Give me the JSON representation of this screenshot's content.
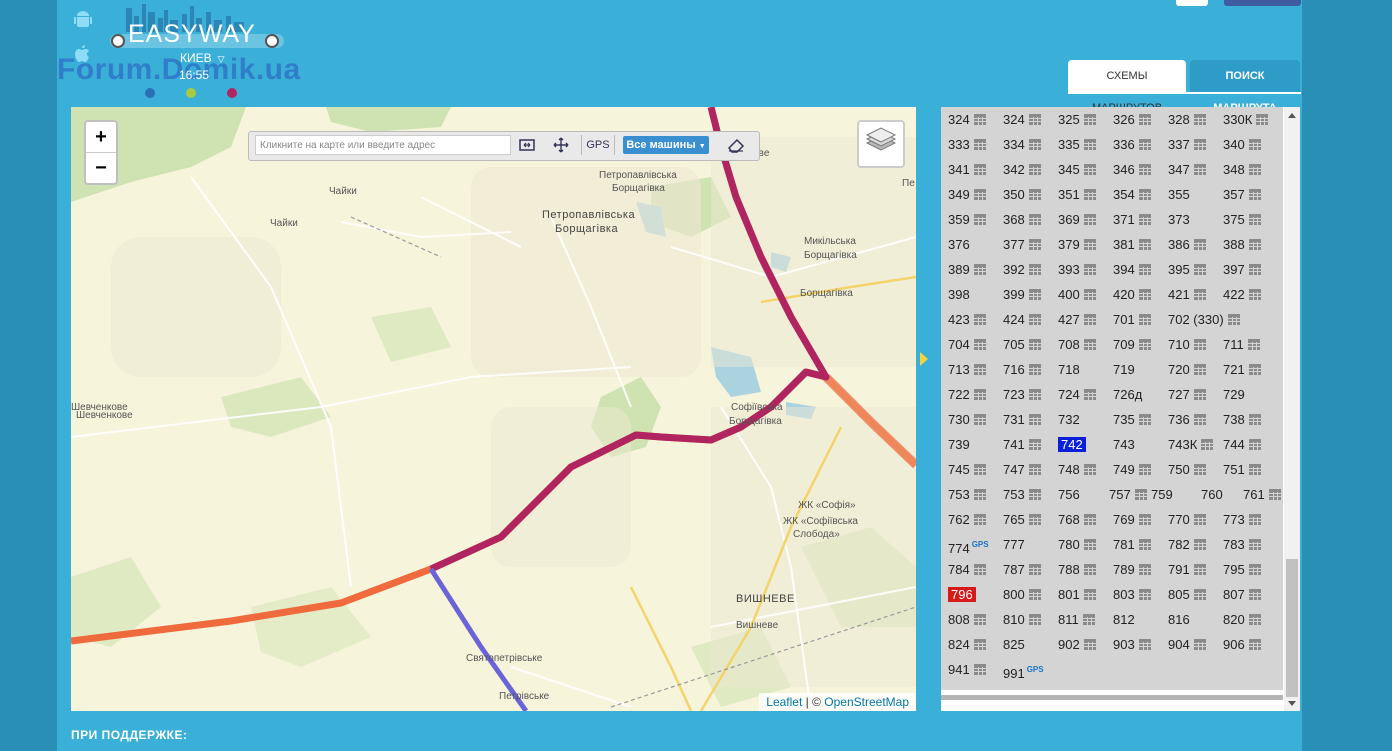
{
  "header": {
    "logo": "EASYWAY",
    "watermark": "Forum.Domik.ua",
    "city": "КИЕВ",
    "time": "16:55"
  },
  "tabs": [
    {
      "label": "СХЕМЫ МАРШРУТОВ",
      "active": true
    },
    {
      "label": "ПОИСК МАРШРУТА",
      "active": false
    }
  ],
  "map": {
    "search_placeholder": "Кликните на карте или введите адрес",
    "gps_label": "GPS",
    "vehicles_label": "Все машины",
    "zoom_in": "+",
    "zoom_out": "−",
    "attribution_leaflet": "Leaflet",
    "attribution_sep": " | © ",
    "attribution_osm": "OpenStreetMap",
    "places": [
      "Чайки",
      "Чайки",
      "Петропавлівська Борщагівка",
      "Петропавлівська",
      "Борщагівка",
      "Петропавлівська",
      "Борщагівка",
      "Микільська",
      "Борщагівка",
      "Борщагівка",
      "Шевченкове",
      "Шевченкове",
      "Софіївська",
      "Борщагівка",
      "ЖК «Софія»",
      "ЖК «Софіївська",
      "Слобода»",
      "ВИШНЕВЕ",
      "Вишневе",
      "Святопетрівське",
      "Петрівське",
      "евe",
      "Пе"
    ]
  },
  "routes_panel": {
    "rows": [
      [
        {
          "n": "324",
          "s": true
        },
        {
          "n": "324",
          "s": true
        },
        {
          "n": "325",
          "s": true
        },
        {
          "n": "326",
          "s": true
        },
        {
          "n": "328",
          "s": true
        },
        {
          "n": "330К",
          "s": true
        }
      ],
      [
        {
          "n": "333",
          "s": true
        },
        {
          "n": "334",
          "s": true
        },
        {
          "n": "335",
          "s": true
        },
        {
          "n": "336",
          "s": true
        },
        {
          "n": "337",
          "s": true
        },
        {
          "n": "340",
          "s": true
        }
      ],
      [
        {
          "n": "341",
          "s": true
        },
        {
          "n": "342",
          "s": true
        },
        {
          "n": "345",
          "s": true
        },
        {
          "n": "346",
          "s": true
        },
        {
          "n": "347",
          "s": true
        },
        {
          "n": "348",
          "s": true
        }
      ],
      [
        {
          "n": "349",
          "s": true
        },
        {
          "n": "350",
          "s": true
        },
        {
          "n": "351",
          "s": true
        },
        {
          "n": "354",
          "s": true
        },
        {
          "n": "355",
          "s": false
        },
        {
          "n": "357",
          "s": true
        }
      ],
      [
        {
          "n": "359",
          "s": true
        },
        {
          "n": "368",
          "s": true
        },
        {
          "n": "369",
          "s": true
        },
        {
          "n": "371",
          "s": true
        },
        {
          "n": "373",
          "s": false
        },
        {
          "n": "375",
          "s": true
        }
      ],
      [
        {
          "n": "376",
          "s": false
        },
        {
          "n": "377",
          "s": true
        },
        {
          "n": "379",
          "s": true
        },
        {
          "n": "381",
          "s": true
        },
        {
          "n": "386",
          "s": true
        },
        {
          "n": "388",
          "s": true
        }
      ],
      [
        {
          "n": "389",
          "s": true
        },
        {
          "n": "392",
          "s": true
        },
        {
          "n": "393",
          "s": true
        },
        {
          "n": "394",
          "s": true
        },
        {
          "n": "395",
          "s": true
        },
        {
          "n": "397",
          "s": true
        }
      ],
      [
        {
          "n": "398",
          "s": false
        },
        {
          "n": "399",
          "s": true
        },
        {
          "n": "400",
          "s": true
        },
        {
          "n": "420",
          "s": true
        },
        {
          "n": "421",
          "s": true
        },
        {
          "n": "422",
          "s": true
        }
      ],
      [
        {
          "n": "423",
          "s": true
        },
        {
          "n": "424",
          "s": true
        },
        {
          "n": "427",
          "s": true
        },
        {
          "n": "701",
          "s": true
        },
        {
          "n": "702 (330)",
          "s": true
        }
      ],
      [
        {
          "n": "704",
          "s": true
        },
        {
          "n": "705",
          "s": true
        },
        {
          "n": "708",
          "s": true
        },
        {
          "n": "709",
          "s": true
        },
        {
          "n": "710",
          "s": true
        },
        {
          "n": "711",
          "s": true
        }
      ],
      [
        {
          "n": "713",
          "s": true
        },
        {
          "n": "716",
          "s": true
        },
        {
          "n": "718",
          "s": false
        },
        {
          "n": "719",
          "s": false
        },
        {
          "n": "720",
          "s": true
        },
        {
          "n": "721",
          "s": true
        }
      ],
      [
        {
          "n": "722",
          "s": true
        },
        {
          "n": "723",
          "s": true
        },
        {
          "n": "724",
          "s": true
        },
        {
          "n": "726д",
          "s": false
        },
        {
          "n": "727",
          "s": true
        },
        {
          "n": "729",
          "s": false
        }
      ],
      [
        {
          "n": "730",
          "s": true
        },
        {
          "n": "731",
          "s": true
        },
        {
          "n": "732",
          "s": false
        },
        {
          "n": "735",
          "s": true
        },
        {
          "n": "736",
          "s": true
        },
        {
          "n": "738",
          "s": true
        }
      ],
      [
        {
          "n": "739",
          "s": false
        },
        {
          "n": "741",
          "s": true
        },
        {
          "n": "742",
          "s": false,
          "sel": true
        },
        {
          "n": "743",
          "s": false
        },
        {
          "n": "743К",
          "s": true
        },
        {
          "n": "744",
          "s": true
        }
      ],
      [
        {
          "n": "745",
          "s": true
        },
        {
          "n": "747",
          "s": true
        },
        {
          "n": "748",
          "s": true
        },
        {
          "n": "749",
          "s": true
        },
        {
          "n": "750",
          "s": true
        },
        {
          "n": "751",
          "s": true
        }
      ],
      [
        {
          "n": "753",
          "s": true
        },
        {
          "n": "753",
          "s": true
        },
        {
          "n": "756",
          "s": false
        },
        {
          "n": "757",
          "s": true
        },
        {
          "n": "759",
          "s": false
        },
        {
          "n": "760",
          "s": false
        },
        {
          "n": "761",
          "s": true
        }
      ],
      [
        {
          "n": "762",
          "s": true
        },
        {
          "n": "765",
          "s": true
        },
        {
          "n": "768",
          "s": true
        },
        {
          "n": "769",
          "s": true
        },
        {
          "n": "770",
          "s": true
        },
        {
          "n": "773",
          "s": true
        }
      ],
      [
        {
          "n": "774",
          "s": false,
          "gps": true
        },
        {
          "n": "777",
          "s": false
        },
        {
          "n": "780",
          "s": true
        },
        {
          "n": "781",
          "s": true
        },
        {
          "n": "782",
          "s": true
        },
        {
          "n": "783",
          "s": true
        }
      ],
      [
        {
          "n": "784",
          "s": true
        },
        {
          "n": "787",
          "s": true
        },
        {
          "n": "788",
          "s": true
        },
        {
          "n": "789",
          "s": true
        },
        {
          "n": "791",
          "s": true
        },
        {
          "n": "795",
          "s": true
        }
      ],
      [
        {
          "n": "796",
          "s": false,
          "hi": true
        },
        {
          "n": "800",
          "s": true
        },
        {
          "n": "801",
          "s": true
        },
        {
          "n": "803",
          "s": true
        },
        {
          "n": "805",
          "s": true
        },
        {
          "n": "807",
          "s": true
        }
      ],
      [
        {
          "n": "808",
          "s": true
        },
        {
          "n": "810",
          "s": true
        },
        {
          "n": "811",
          "s": true
        },
        {
          "n": "812",
          "s": false
        },
        {
          "n": "816",
          "s": false
        },
        {
          "n": "820",
          "s": true
        }
      ],
      [
        {
          "n": "824",
          "s": true
        },
        {
          "n": "825",
          "s": false
        },
        {
          "n": "902",
          "s": true
        },
        {
          "n": "903",
          "s": true
        },
        {
          "n": "904",
          "s": true
        },
        {
          "n": "906",
          "s": true
        }
      ],
      [
        {
          "n": "941",
          "s": true
        },
        {
          "n": "991",
          "s": false,
          "gps": true
        }
      ]
    ],
    "gps_tag": "GPS"
  },
  "footer": {
    "label": "ПРИ ПОДДЕРЖКЕ:"
  },
  "colors": {
    "page_bg": "#3ab0d9",
    "route_main": "#b0245f",
    "route_orange": "#ef6a3c",
    "route_blue": "#6b64d8",
    "selected_route": "#0a1fd8",
    "highlight_route": "#d61a1a"
  }
}
